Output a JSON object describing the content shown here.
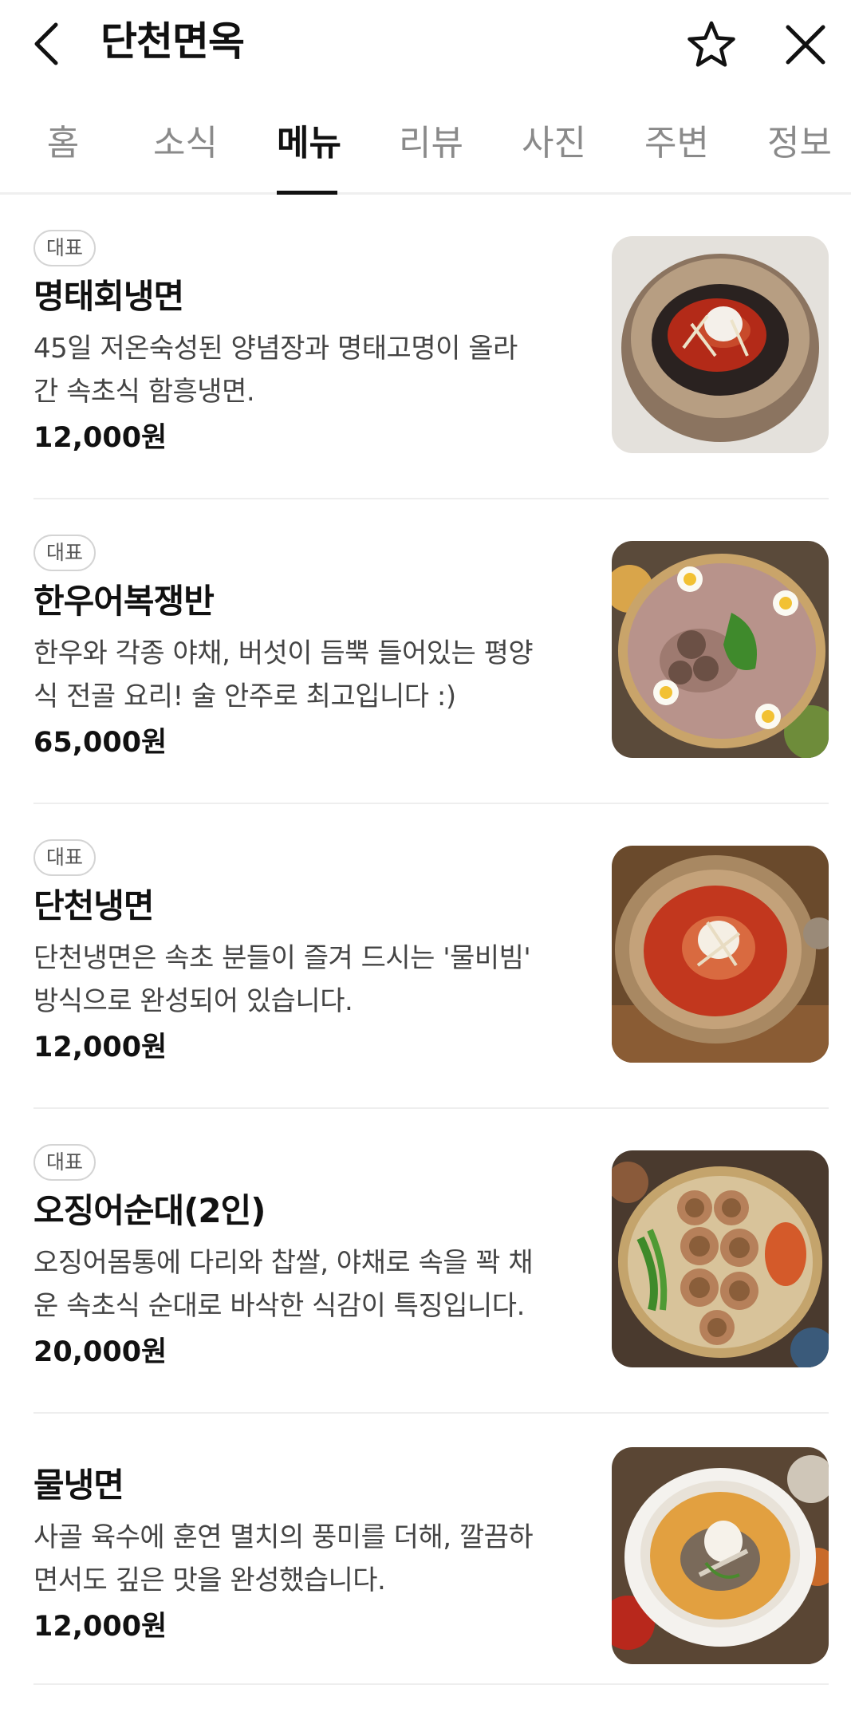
{
  "header": {
    "title": "단천면옥",
    "back_icon": "chevron-left-icon",
    "favorite_icon": "star-outline-icon",
    "close_icon": "close-icon"
  },
  "tabs": [
    {
      "label": "홈",
      "active": false
    },
    {
      "label": "소식",
      "active": false
    },
    {
      "label": "메뉴",
      "active": true
    },
    {
      "label": "리뷰",
      "active": false
    },
    {
      "label": "사진",
      "active": false
    },
    {
      "label": "주변",
      "active": false
    },
    {
      "label": "정보",
      "active": false
    }
  ],
  "menu": [
    {
      "badge": "대표",
      "name": "명태회냉면",
      "desc_line1": "45일 저온숙성된 양념장과 명태고명이 올라",
      "desc_line2": "간 속초식 함흥냉면.",
      "price": "12,000원"
    },
    {
      "badge": "대표",
      "name": "한우어복쟁반",
      "desc_line1": "한우와 각종 야채, 버섯이 듬뿍 들어있는 평양",
      "desc_line2": "식 전골 요리! 술 안주로 최고입니다 :)",
      "price": "65,000원"
    },
    {
      "badge": "대표",
      "name": "단천냉면",
      "desc_line1": "단천냉면은 속초 분들이 즐겨 드시는 '물비빔'",
      "desc_line2": "방식으로 완성되어 있습니다.",
      "price": "12,000원"
    },
    {
      "badge": "대표",
      "name": "오징어순대(2인)",
      "desc_line1": "오징어몸통에 다리와 찹쌀, 야채로 속을 꽉 채",
      "desc_line2": "운 속초식 순대로 바삭한 식감이 특징입니다.",
      "price": "20,000원"
    },
    {
      "badge": "",
      "name": "물냉면",
      "desc_line1": "사골 육수에 훈연 멸치의 풍미를 더해, 깔끔하",
      "desc_line2": "면서도 깊은 맛을 완성했습니다.",
      "price": "12,000원"
    }
  ]
}
